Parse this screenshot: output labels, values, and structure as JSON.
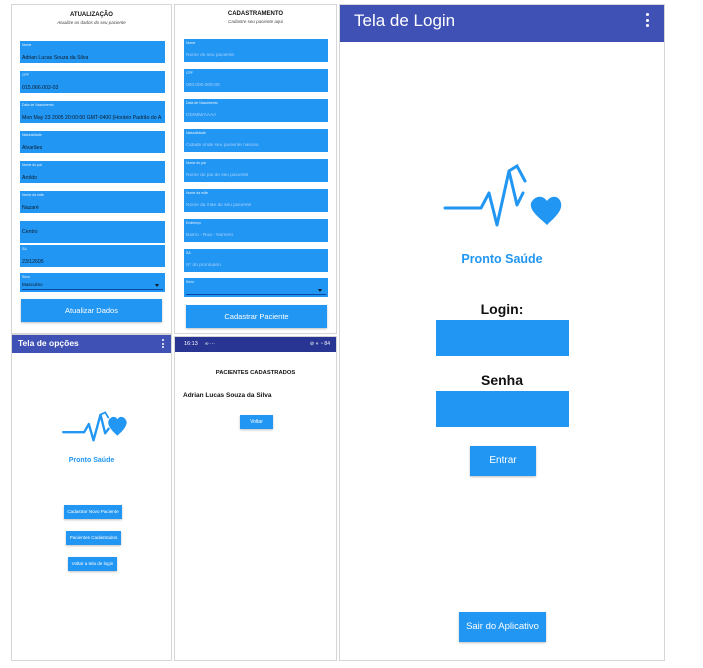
{
  "atualizacao": {
    "title": "ATUALIZAÇÃO",
    "subtitle": "Atualize os dados do seu paciente",
    "fields": [
      {
        "label": "Nome",
        "value": "Adrian Lucas Souza da Silva"
      },
      {
        "label": "CPF",
        "value": "015.066.002-03"
      },
      {
        "label": "Data de Nascimento",
        "value": "Mon May 23 2005 20:00:00 GMT-0400 (Horário Padrão do A"
      },
      {
        "label": "Naturalidade",
        "value": "Alvarães"
      },
      {
        "label": "Nome do pai",
        "value": "Aroldo"
      },
      {
        "label": "Nome da mãe",
        "value": "Nazaré"
      },
      {
        "label": "",
        "value": "Centro"
      },
      {
        "label": "SA",
        "value": "23/12605"
      }
    ],
    "sexo_label": "Sexo",
    "sexo_value": "Masculino",
    "button": "Atualizar Dados"
  },
  "cadastramento": {
    "title": "CADASTRAMENTO",
    "subtitle": "Cadastre seu paciente aqui",
    "fields": [
      {
        "label": "Nome",
        "placeholder": "Nome do seu paciente"
      },
      {
        "label": "CPF",
        "placeholder": "000.000.000-00"
      },
      {
        "label": "Data de Nascimento",
        "placeholder": "DD/MM/AAAA"
      },
      {
        "label": "Naturalidade",
        "placeholder": "Cidade onde seu paciente nasceu"
      },
      {
        "label": "Nome do pai",
        "placeholder": "Nome do pai do seu paciente"
      },
      {
        "label": "Nome da mãe",
        "placeholder": "Nome da mãe do seu paciente"
      },
      {
        "label": "Endereço",
        "placeholder": "Bairro - Rua - Número"
      },
      {
        "label": "SA",
        "placeholder": "Nº do prontuário"
      }
    ],
    "sexo_label": "Sexo",
    "button": "Cadastrar Paciente"
  },
  "opcoes": {
    "appbar_title": "Tela de opções",
    "logo_text": "Pronto Saúde",
    "buttons": [
      "Cadastrar Novo Paciente",
      "Pacientes Cadastrados",
      "Voltar a tela de login"
    ]
  },
  "pacientes": {
    "status_time": "16:13",
    "status_extra": "∞ ···",
    "status_right": "⊘ ⋄ ◔ 84",
    "title": "PACIENTES CADASTRADOS",
    "patient_name": "Adrian Lucas Souza da Silva",
    "button": "Voltar"
  },
  "login": {
    "appbar_title": "Tela de Login",
    "logo_text": "Pronto Saúde",
    "login_label": "Login:",
    "senha_label": "Senha",
    "login_value": "",
    "senha_value": "",
    "enter_button": "Entrar",
    "exit_button": "Sair do Aplicativo"
  },
  "colors": {
    "appbar": "#3f51b5",
    "accent": "#2196f3",
    "statusbar": "#283593"
  }
}
